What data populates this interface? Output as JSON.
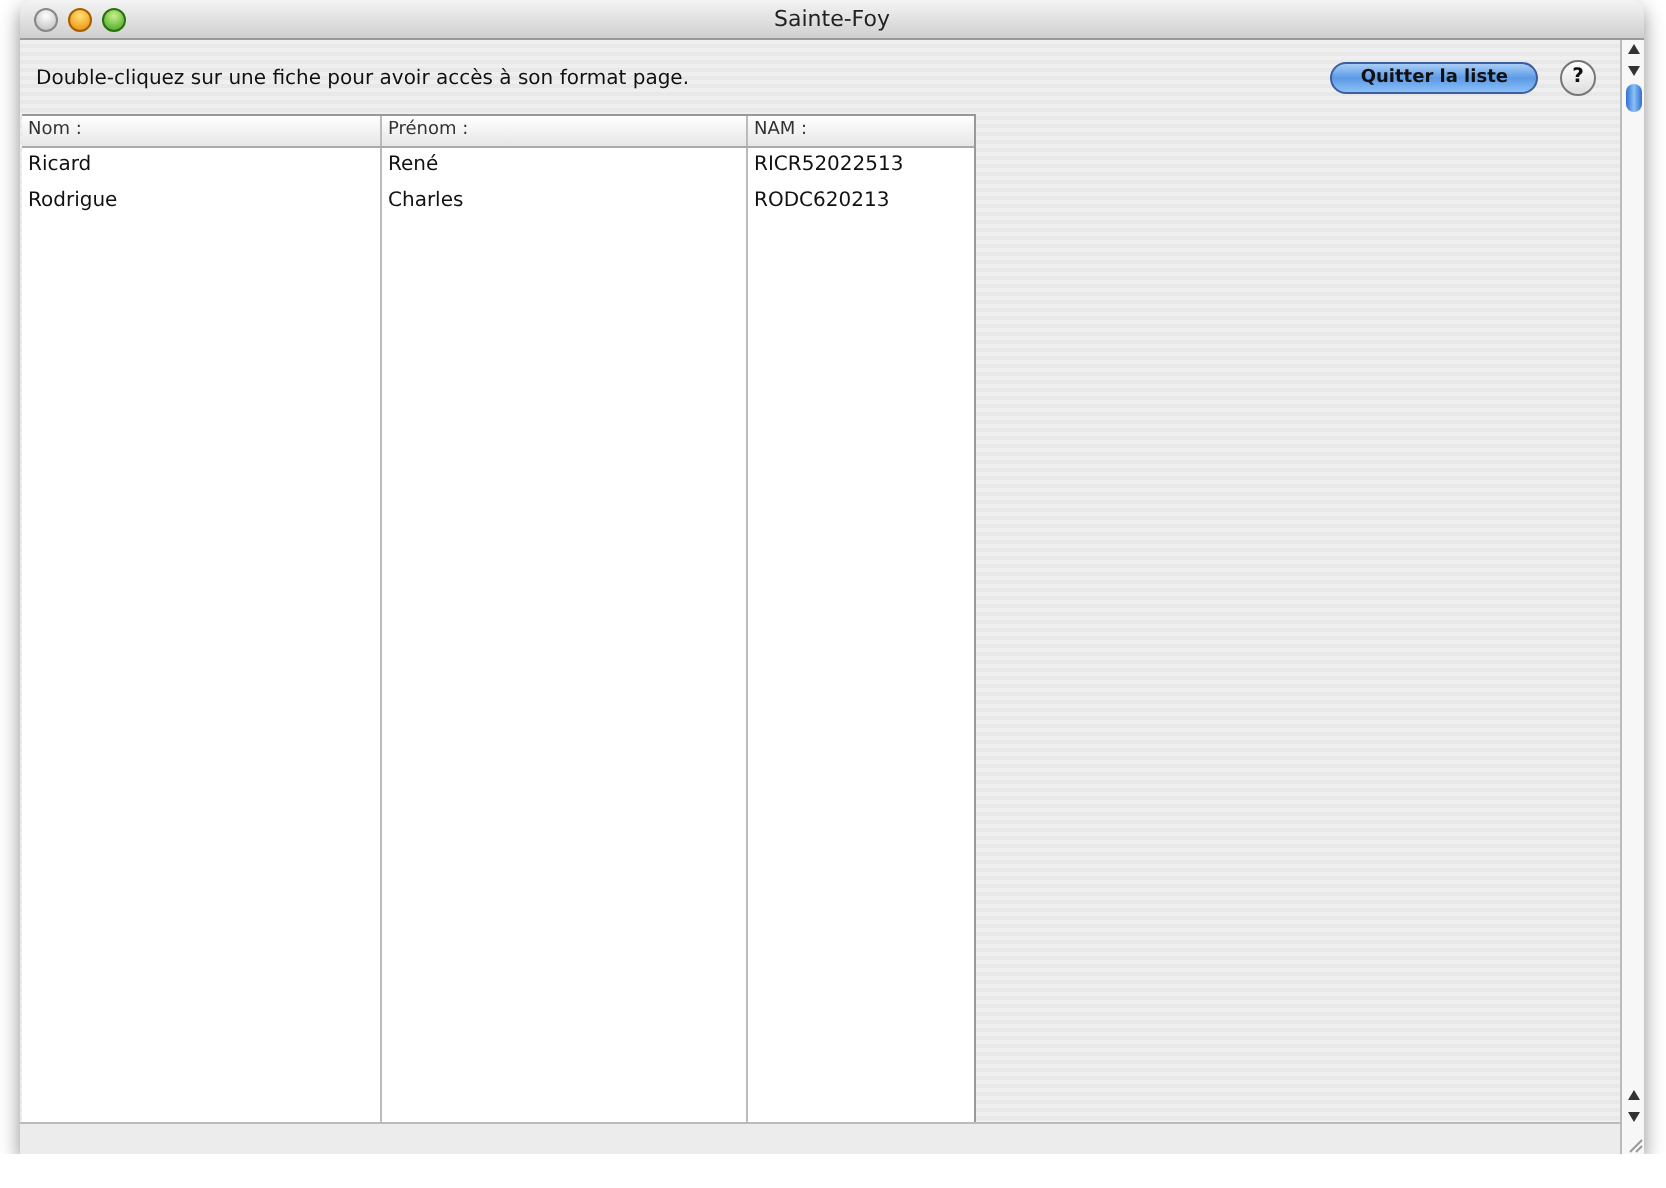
{
  "window": {
    "title": "Sainte-Foy"
  },
  "instruction": "Double-cliquez sur une fiche pour avoir accès à son format page.",
  "buttons": [
    {
      "label": "Quitter la liste",
      "kind": "primary"
    },
    {
      "label": "?",
      "kind": "help"
    }
  ],
  "table": {
    "columns": [
      "Nom :",
      "Prénom :",
      "NAM :"
    ],
    "rows": [
      [
        "Ricard",
        "René",
        "RICR52022513"
      ],
      [
        "Rodrigue",
        "Charles",
        "RODC620213"
      ]
    ]
  }
}
